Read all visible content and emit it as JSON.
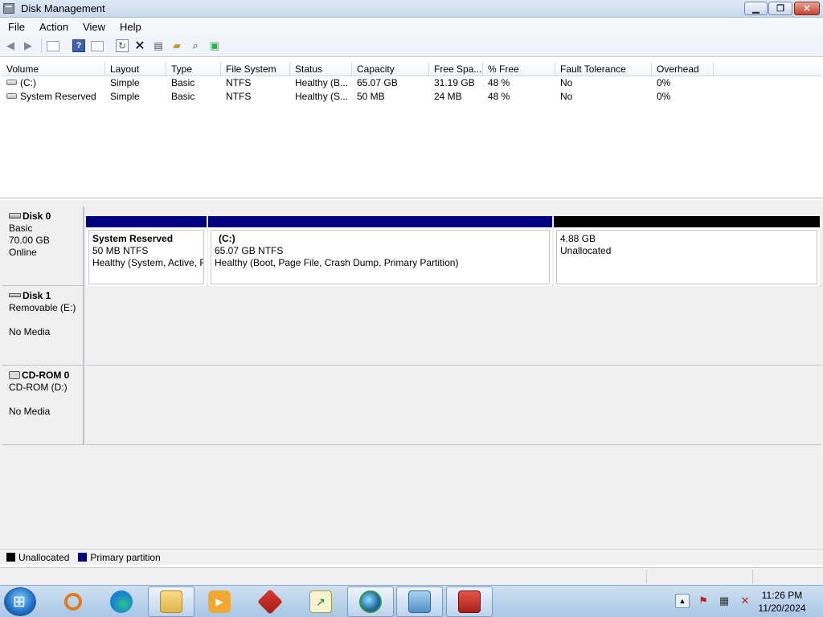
{
  "window": {
    "title": "Disk Management"
  },
  "menu": [
    "File",
    "Action",
    "View",
    "Help"
  ],
  "volume_list": {
    "columns": [
      "Volume",
      "Layout",
      "Type",
      "File System",
      "Status",
      "Capacity",
      "Free Spa...",
      "% Free",
      "Fault Tolerance",
      "Overhead"
    ],
    "rows": [
      [
        "(C:)",
        "Simple",
        "Basic",
        "NTFS",
        "Healthy (B...",
        "65.07 GB",
        "31.19 GB",
        "48 %",
        "No",
        "0%"
      ],
      [
        "System Reserved",
        "Simple",
        "Basic",
        "NTFS",
        "Healthy (S...",
        "50 MB",
        "24 MB",
        "48 %",
        "No",
        "0%"
      ]
    ]
  },
  "disks": [
    {
      "name": "Disk 0",
      "lines": [
        "Basic",
        "70.00 GB",
        "Online"
      ],
      "partitions": [
        {
          "name": "System Reserved",
          "size": "50 MB NTFS",
          "status": "Healthy (System, Active, F",
          "kind": "primary"
        },
        {
          "name": "(C:)",
          "size": "65.07 GB NTFS",
          "status": "Healthy (Boot, Page File, Crash Dump, Primary Partition)",
          "kind": "primary"
        },
        {
          "name": "",
          "size": "4.88 GB",
          "status": "Unallocated",
          "kind": "unallocated"
        }
      ]
    },
    {
      "name": "Disk 1",
      "lines": [
        "Removable (E:)",
        "",
        "No Media"
      ]
    },
    {
      "name": "CD-ROM 0",
      "lines": [
        "CD-ROM (D:)",
        "",
        "No Media"
      ]
    }
  ],
  "legend": [
    {
      "label": "Unallocated",
      "color": "#000000"
    },
    {
      "label": "Primary partition",
      "color": "#000080"
    }
  ],
  "taskbar": {
    "clock_time": "11:26 PM",
    "clock_date": "11/20/2024",
    "icons": [
      "start-orb",
      "search-magnifier",
      "edge-browser",
      "file-explorer",
      "media-player",
      "red-app",
      "notepad-chart",
      "globe-app",
      "control-panel",
      "toolbox"
    ]
  },
  "colors": {
    "primary_partition": "#000080",
    "unallocated": "#000000"
  }
}
